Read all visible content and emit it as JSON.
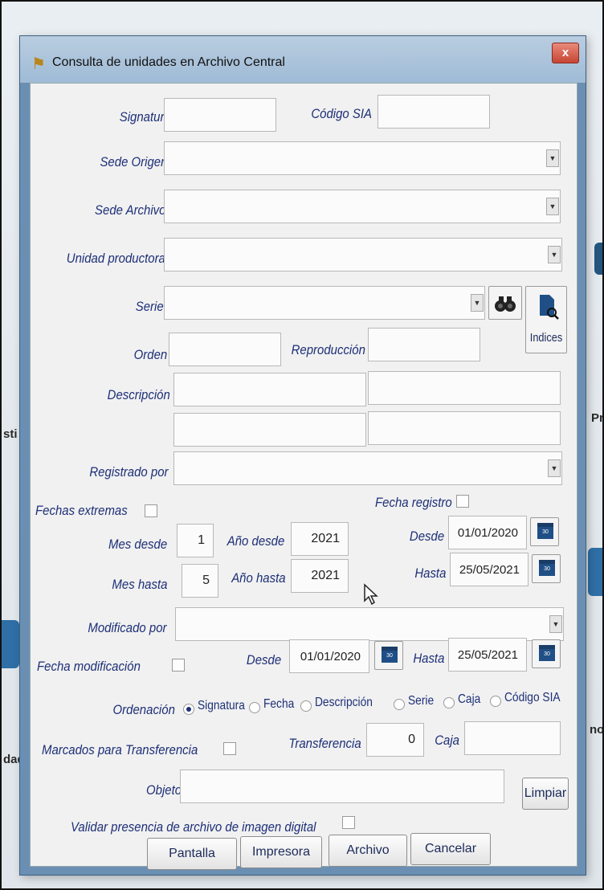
{
  "dialog": {
    "title": "Consulta de unidades en Archivo Central",
    "close_label": "x"
  },
  "background": {
    "left_text_1": "sti",
    "left_text_2": "dade",
    "right_text_1": "Pr",
    "right_text_2": "no:"
  },
  "form": {
    "signatura": {
      "label": "Signatura",
      "value": ""
    },
    "codigo_sia": {
      "label": "Código SIA",
      "value": ""
    },
    "sede_origen": {
      "label": "Sede Origen",
      "value": ""
    },
    "sede_archivo": {
      "label": "Sede Archivo",
      "value": ""
    },
    "unidad_productora": {
      "label": "Unidad productora",
      "value": ""
    },
    "serie": {
      "label": "Serie",
      "value": ""
    },
    "indices_button": {
      "label": "Indices"
    },
    "orden": {
      "label": "Orden",
      "value": ""
    },
    "reproduccion": {
      "label": "Reproducción",
      "value": ""
    },
    "descripcion": {
      "label": "Descripción"
    },
    "registrado_por": {
      "label": "Registrado por",
      "value": ""
    },
    "fechas_extremas": {
      "label": "Fechas extremas",
      "checked": false
    },
    "fecha_registro": {
      "label": "Fecha registro",
      "checked": false
    },
    "mes_desde": {
      "label": "Mes desde",
      "value": "1"
    },
    "anio_desde": {
      "label": "Año desde",
      "value": "2021"
    },
    "desde_registro": {
      "label": "Desde",
      "value": "01/01/2020"
    },
    "mes_hasta": {
      "label": "Mes hasta",
      "value": "5"
    },
    "anio_hasta": {
      "label": "Año hasta",
      "value": "2021"
    },
    "hasta_registro": {
      "label": "Hasta",
      "value": "25/05/2021"
    },
    "modificado_por": {
      "label": "Modificado por",
      "value": ""
    },
    "fecha_modificacion": {
      "label": "Fecha modificación",
      "checked": false
    },
    "desde_modificacion": {
      "label": "Desde",
      "value": "01/01/2020"
    },
    "hasta_modificacion": {
      "label": "Hasta",
      "value": "25/05/2021"
    },
    "ordenacion": {
      "label": "Ordenación",
      "options": [
        "Signatura",
        "Fecha",
        "Descripción",
        "Serie",
        "Caja",
        "Código SIA"
      ],
      "selected": "Signatura"
    },
    "marcados_transferencia": {
      "label": "Marcados para Transferencia",
      "checked": false
    },
    "transferencia": {
      "label": "Transferencia",
      "value": "0"
    },
    "caja": {
      "label": "Caja",
      "value": ""
    },
    "objeto": {
      "label": "Objeto",
      "value": ""
    },
    "limpiar_button": {
      "label": "Limpiar"
    },
    "validar_imagen": {
      "label": "Validar presencia de archivo de imagen digital",
      "checked": false
    }
  },
  "buttons": {
    "pantalla": "Pantalla",
    "impresora": "Impresora",
    "archivo": "Archivo",
    "cancelar": "Cancelar"
  },
  "calendar_icon_text": "30"
}
